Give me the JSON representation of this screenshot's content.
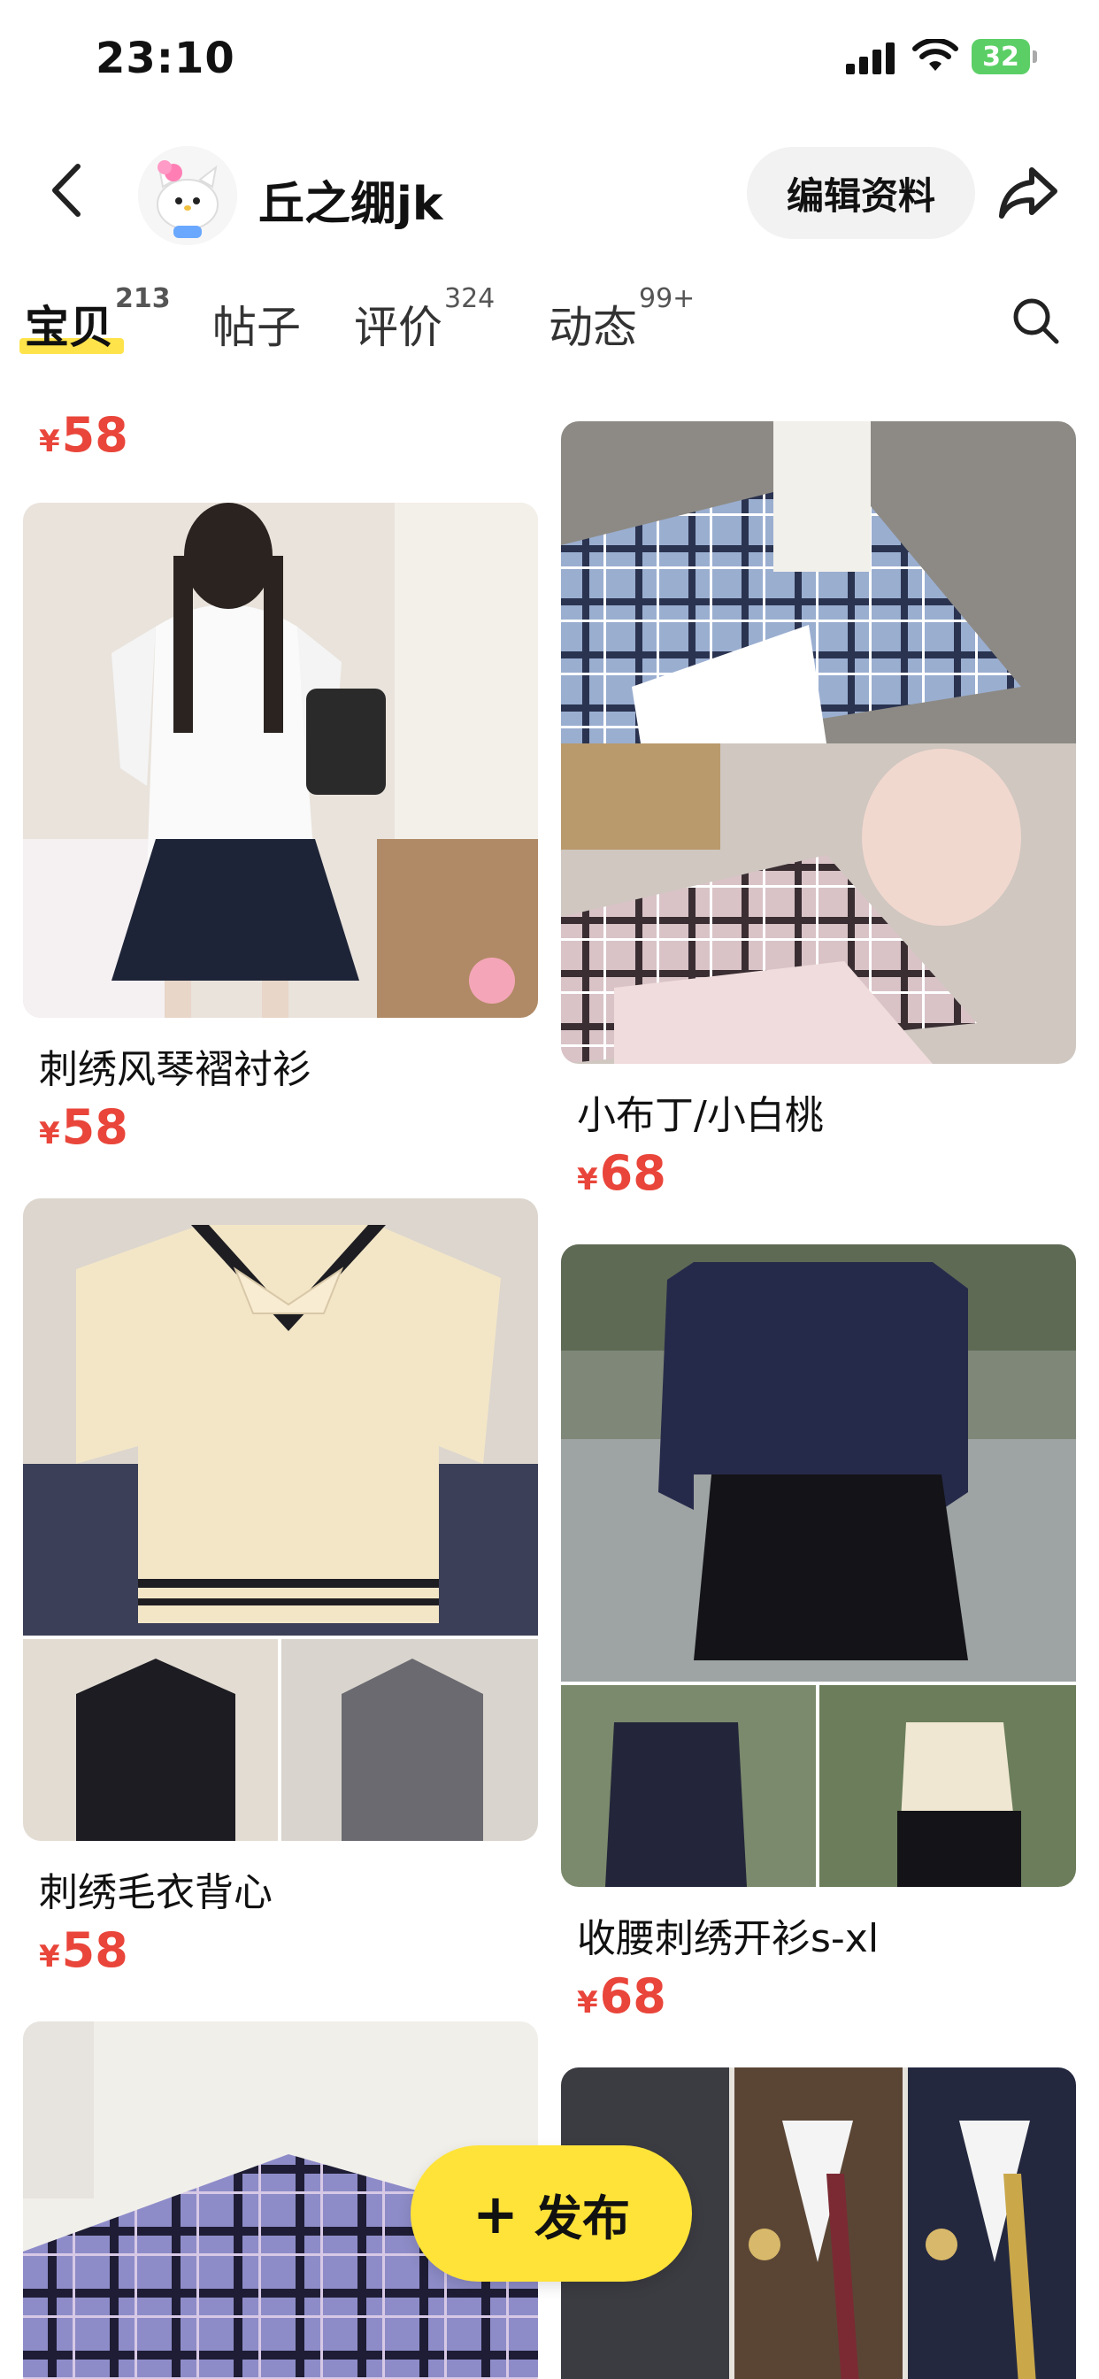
{
  "status_bar": {
    "time": "23:10",
    "battery": "32"
  },
  "profile": {
    "username": "丘之绷jk",
    "edit_label": "编辑资料"
  },
  "tabs": [
    {
      "label": "宝贝",
      "count": "213"
    },
    {
      "label": "帖子",
      "count": ""
    },
    {
      "label": "评价",
      "count": "324"
    },
    {
      "label": "动态",
      "count": "99+"
    }
  ],
  "items": [
    {
      "title": "",
      "price": "58"
    },
    {
      "title": "刺绣风琴褶衬衫",
      "price": "58"
    },
    {
      "title": "小布丁/小白桃",
      "price": "68"
    },
    {
      "title": "刺绣毛衣背心",
      "price": "58"
    },
    {
      "title": "收腰刺绣开衫s-xl",
      "price": "68"
    }
  ],
  "currency_symbol": "¥",
  "publish_label": "发布",
  "colors": {
    "accent": "#ffe338",
    "price": "#e9453a"
  }
}
